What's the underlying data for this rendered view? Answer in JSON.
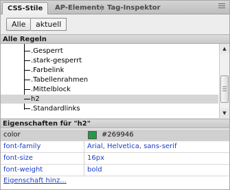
{
  "tabs": [
    {
      "label": "CSS-Stile",
      "active": true
    },
    {
      "label": "AP-Elemente",
      "active": false
    },
    {
      "label": "Tag-Inspektor",
      "active": false
    }
  ],
  "toolbar": {
    "all_label": "Alle",
    "current_label": "aktuell"
  },
  "rules": {
    "header": "Alle Regeln",
    "items": [
      {
        "label": ".Gesperrt"
      },
      {
        "label": ".stark-gesperrt"
      },
      {
        "label": ".Farbelink"
      },
      {
        "label": ".Tabellenrahmen"
      },
      {
        "label": ".Mittelblock"
      },
      {
        "label": "h2",
        "selected": true
      },
      {
        "label": ".Standardlinks"
      }
    ]
  },
  "properties": {
    "header": "Eigenschaften für \"h2\"",
    "rows": [
      {
        "name": "color",
        "value": "#269946",
        "swatch": "#269946"
      },
      {
        "name": "font-family",
        "value": "Arial, Helvetica, sans-serif"
      },
      {
        "name": "font-size",
        "value": "16px"
      },
      {
        "name": "font-weight",
        "value": "bold"
      }
    ],
    "add_label": "Eigenschaft hinz..."
  },
  "colors": {
    "selected_row": "#d6d6d6",
    "link": "#1a3cc8"
  },
  "icons": {
    "panel_menu": "panel-menu-icon",
    "scroll_up": "scroll-up-icon",
    "scroll_down": "scroll-down-icon"
  }
}
